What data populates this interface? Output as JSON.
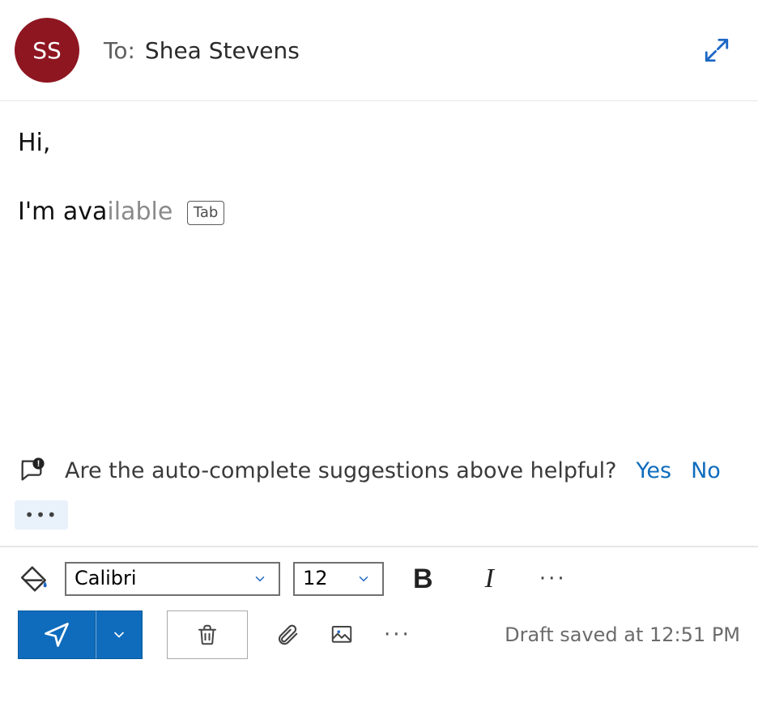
{
  "header": {
    "avatar_initials": "SS",
    "to_label": "To:",
    "to_value": "Shea Stevens"
  },
  "body": {
    "line1": "Hi,",
    "line2_typed": "I'm ava",
    "line2_suggestion": "ilable",
    "tab_hint_label": "Tab"
  },
  "feedback": {
    "question": "Are the auto-complete suggestions above helpful?",
    "yes_label": "Yes",
    "no_label": "No"
  },
  "format_toolbar": {
    "font_value": "Calibri",
    "size_value": "12",
    "bold_glyph": "B",
    "italic_glyph": "I",
    "more_glyph": "···"
  },
  "action_bar": {
    "more_glyph": "···"
  },
  "status": {
    "draft_saved": "Draft saved at 12:51 PM"
  },
  "misc": {
    "ellipsis": "•••"
  }
}
